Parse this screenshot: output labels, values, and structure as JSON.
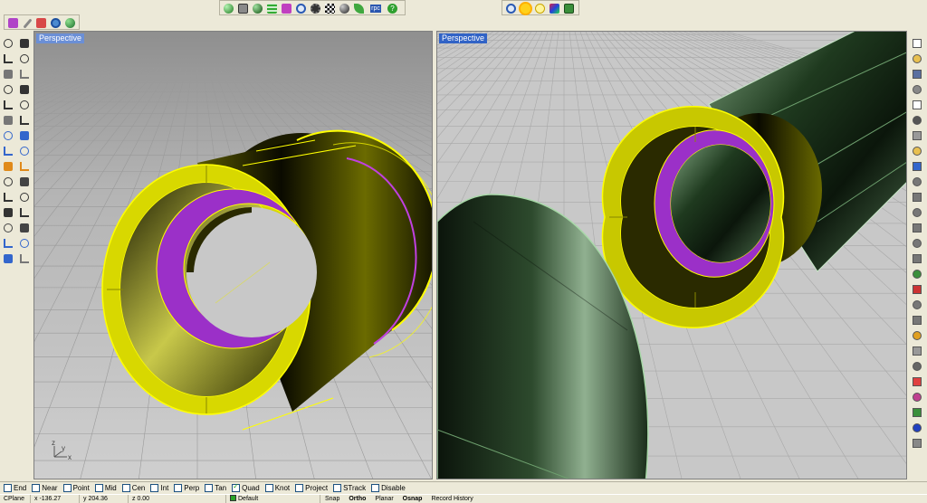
{
  "viewports": {
    "left": {
      "title": "Perspective",
      "axis_x": "x",
      "axis_y": "y",
      "axis_z": "z"
    },
    "right": {
      "title": "Perspective"
    }
  },
  "colors": {
    "grid_bg": "#c4c4c4",
    "grid_line": "#aaaaaa",
    "yellow": "#ffff00",
    "purple": "#aa3ad6",
    "dark_green": "#2e4a2e",
    "viewport_title_bg": "#3163c6"
  },
  "toolbars": {
    "top_left": [
      "paint-icon",
      "pencil-icon",
      "brush-icon",
      "search-icon",
      "globe-icon"
    ],
    "top_center": [
      "sphere-icon",
      "layers-icon",
      "render-icon",
      "grid-icon",
      "figure-icon",
      "search-icon",
      "gear-icon",
      "checker-icon",
      "render-globe-icon",
      "leaf-icon",
      "rpc-icon",
      "help-icon"
    ],
    "top_center_rpc_label": "rpc",
    "top_right": [
      "zoom-icon",
      "sun-icon",
      "lightbulb-icon",
      "texture-icon",
      "camera-icon"
    ],
    "left": [
      "select-arrow-icon",
      "point-icon",
      "polyline-icon",
      "curve-icon",
      "circle-icon",
      "circle-alt-icon",
      "arc-icon",
      "rectangle-icon",
      "polygon-icon",
      "fillet-curve-icon",
      "gear-curve-icon",
      "trim-icon",
      "box-icon",
      "surface-icon",
      "cylinder-icon",
      "plane-surface-icon",
      "boolean-icon",
      "explode-icon",
      "drape-icon",
      "move-icon",
      "sweep-icon",
      "network-icon",
      "bend-icon",
      "rotate-icon",
      "torus-icon",
      "rotate-3d-icon",
      "array-icon",
      "scale-icon",
      "mesh-icon",
      "dimension-icon"
    ],
    "right": [
      "new-file-icon",
      "open-folder-icon",
      "save-icon",
      "print-icon",
      "import-icon",
      "cut-icon",
      "copy-icon",
      "paste-icon",
      "undo-icon",
      "pan-hand-icon",
      "rotate-view-icon",
      "zoom-in-icon",
      "zoom-window-icon",
      "zoom-extents-icon",
      "zoom-selected-icon",
      "four-views-icon",
      "car-icon",
      "eye-icon",
      "target-icon",
      "link-icon",
      "light-icon",
      "lock-icon",
      "layers-icon",
      "color-wheel-icon",
      "palette-icon",
      "sphere-icon",
      "arrow-icon"
    ]
  },
  "osnap": [
    {
      "label": "End",
      "checked": false
    },
    {
      "label": "Near",
      "checked": false
    },
    {
      "label": "Point",
      "checked": false
    },
    {
      "label": "Mid",
      "checked": false
    },
    {
      "label": "Cen",
      "checked": false
    },
    {
      "label": "Int",
      "checked": false
    },
    {
      "label": "Perp",
      "checked": false
    },
    {
      "label": "Tan",
      "checked": false
    },
    {
      "label": "Quad",
      "checked": true
    },
    {
      "label": "Knot",
      "checked": false
    },
    {
      "label": "Project",
      "checked": false
    },
    {
      "label": "STrack",
      "checked": false
    },
    {
      "label": "Disable",
      "checked": false
    }
  ],
  "status": {
    "cplane": "CPlane",
    "x": "x -136.27",
    "y": "y 204.36",
    "z": "z 0.00",
    "layer": "Default",
    "snap": "Snap",
    "ortho": "Ortho",
    "planar": "Planar",
    "osnap": "Osnap",
    "record_history": "Record History"
  }
}
